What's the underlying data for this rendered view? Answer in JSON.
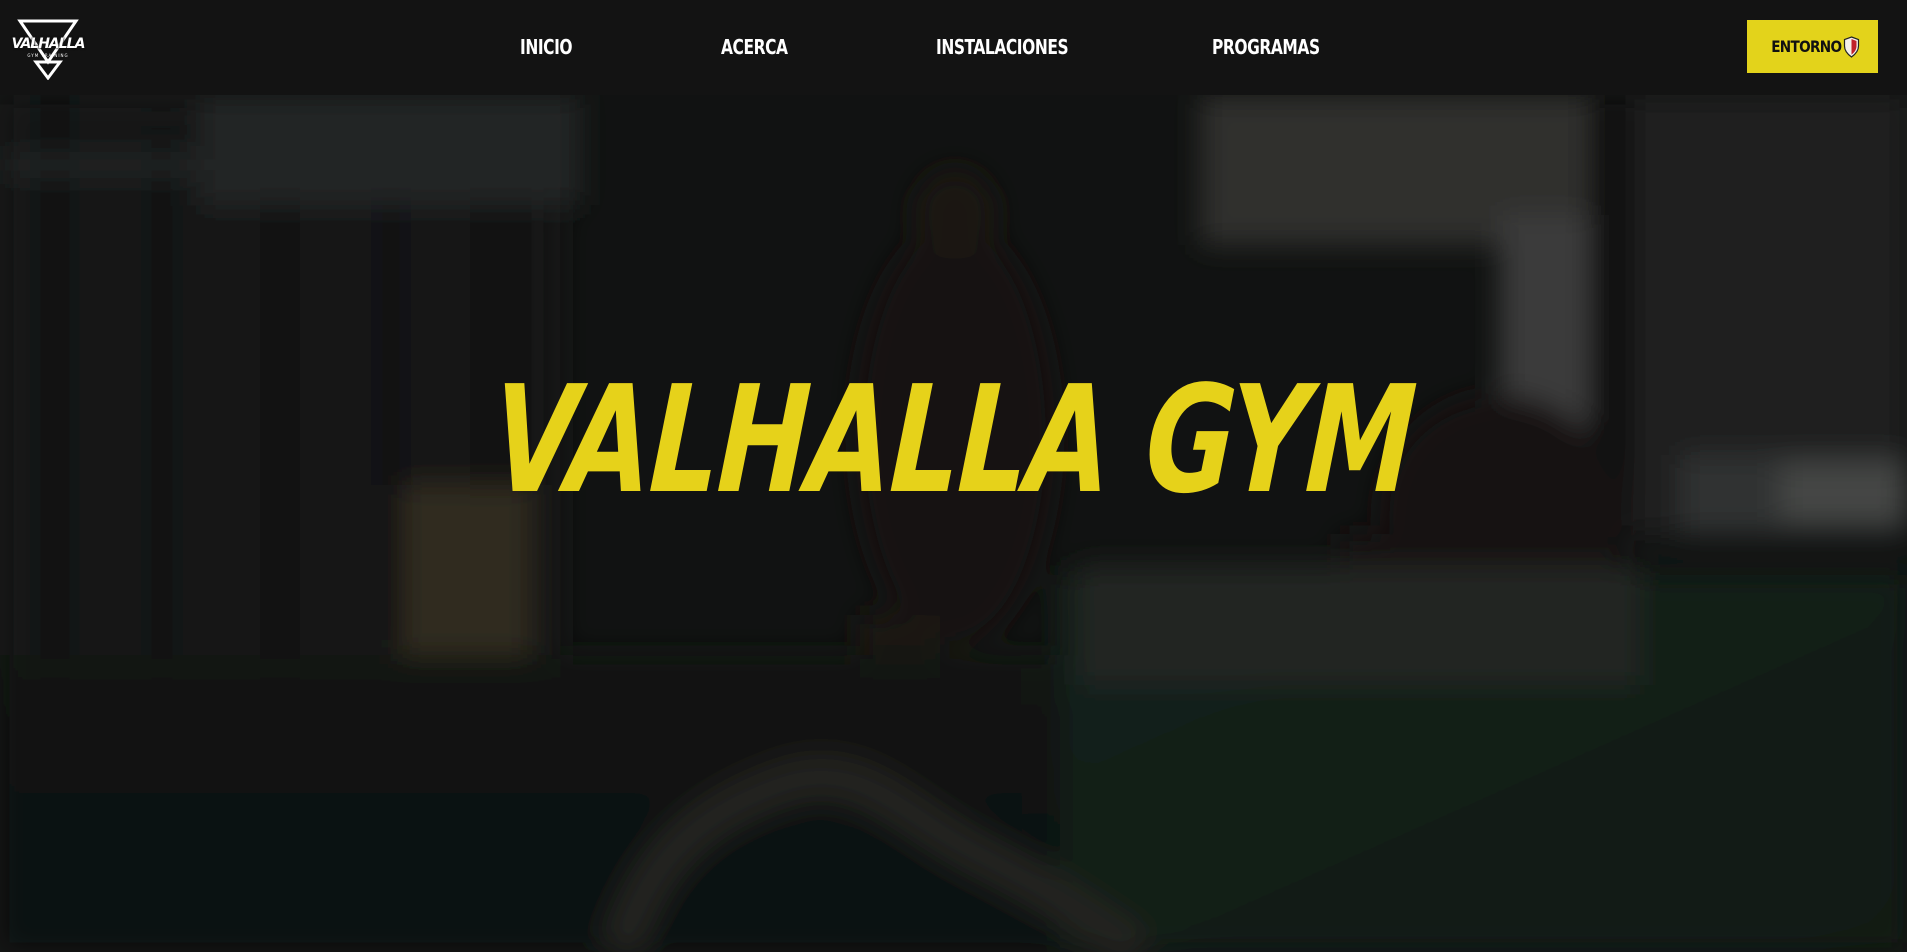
{
  "brand": {
    "logo_name": "VALHALLA",
    "logo_tagline": "GYM TRAINING",
    "logo_icon": "triangle-logo-icon"
  },
  "nav": {
    "items": [
      {
        "label": "INICIO"
      },
      {
        "label": "ACERCA"
      },
      {
        "label": "INSTALACIONES"
      },
      {
        "label": "PROGRAMAS"
      }
    ]
  },
  "cta": {
    "label": "ENTORNO",
    "icon": "shield-icon"
  },
  "hero": {
    "title": "VALHALLA GYM",
    "background": "blurred-gym-photo"
  },
  "colors": {
    "accent": "#e3d31b",
    "header_bg": "#131313",
    "nav_text": "#ffffff",
    "shield_red": "#c0202a"
  }
}
